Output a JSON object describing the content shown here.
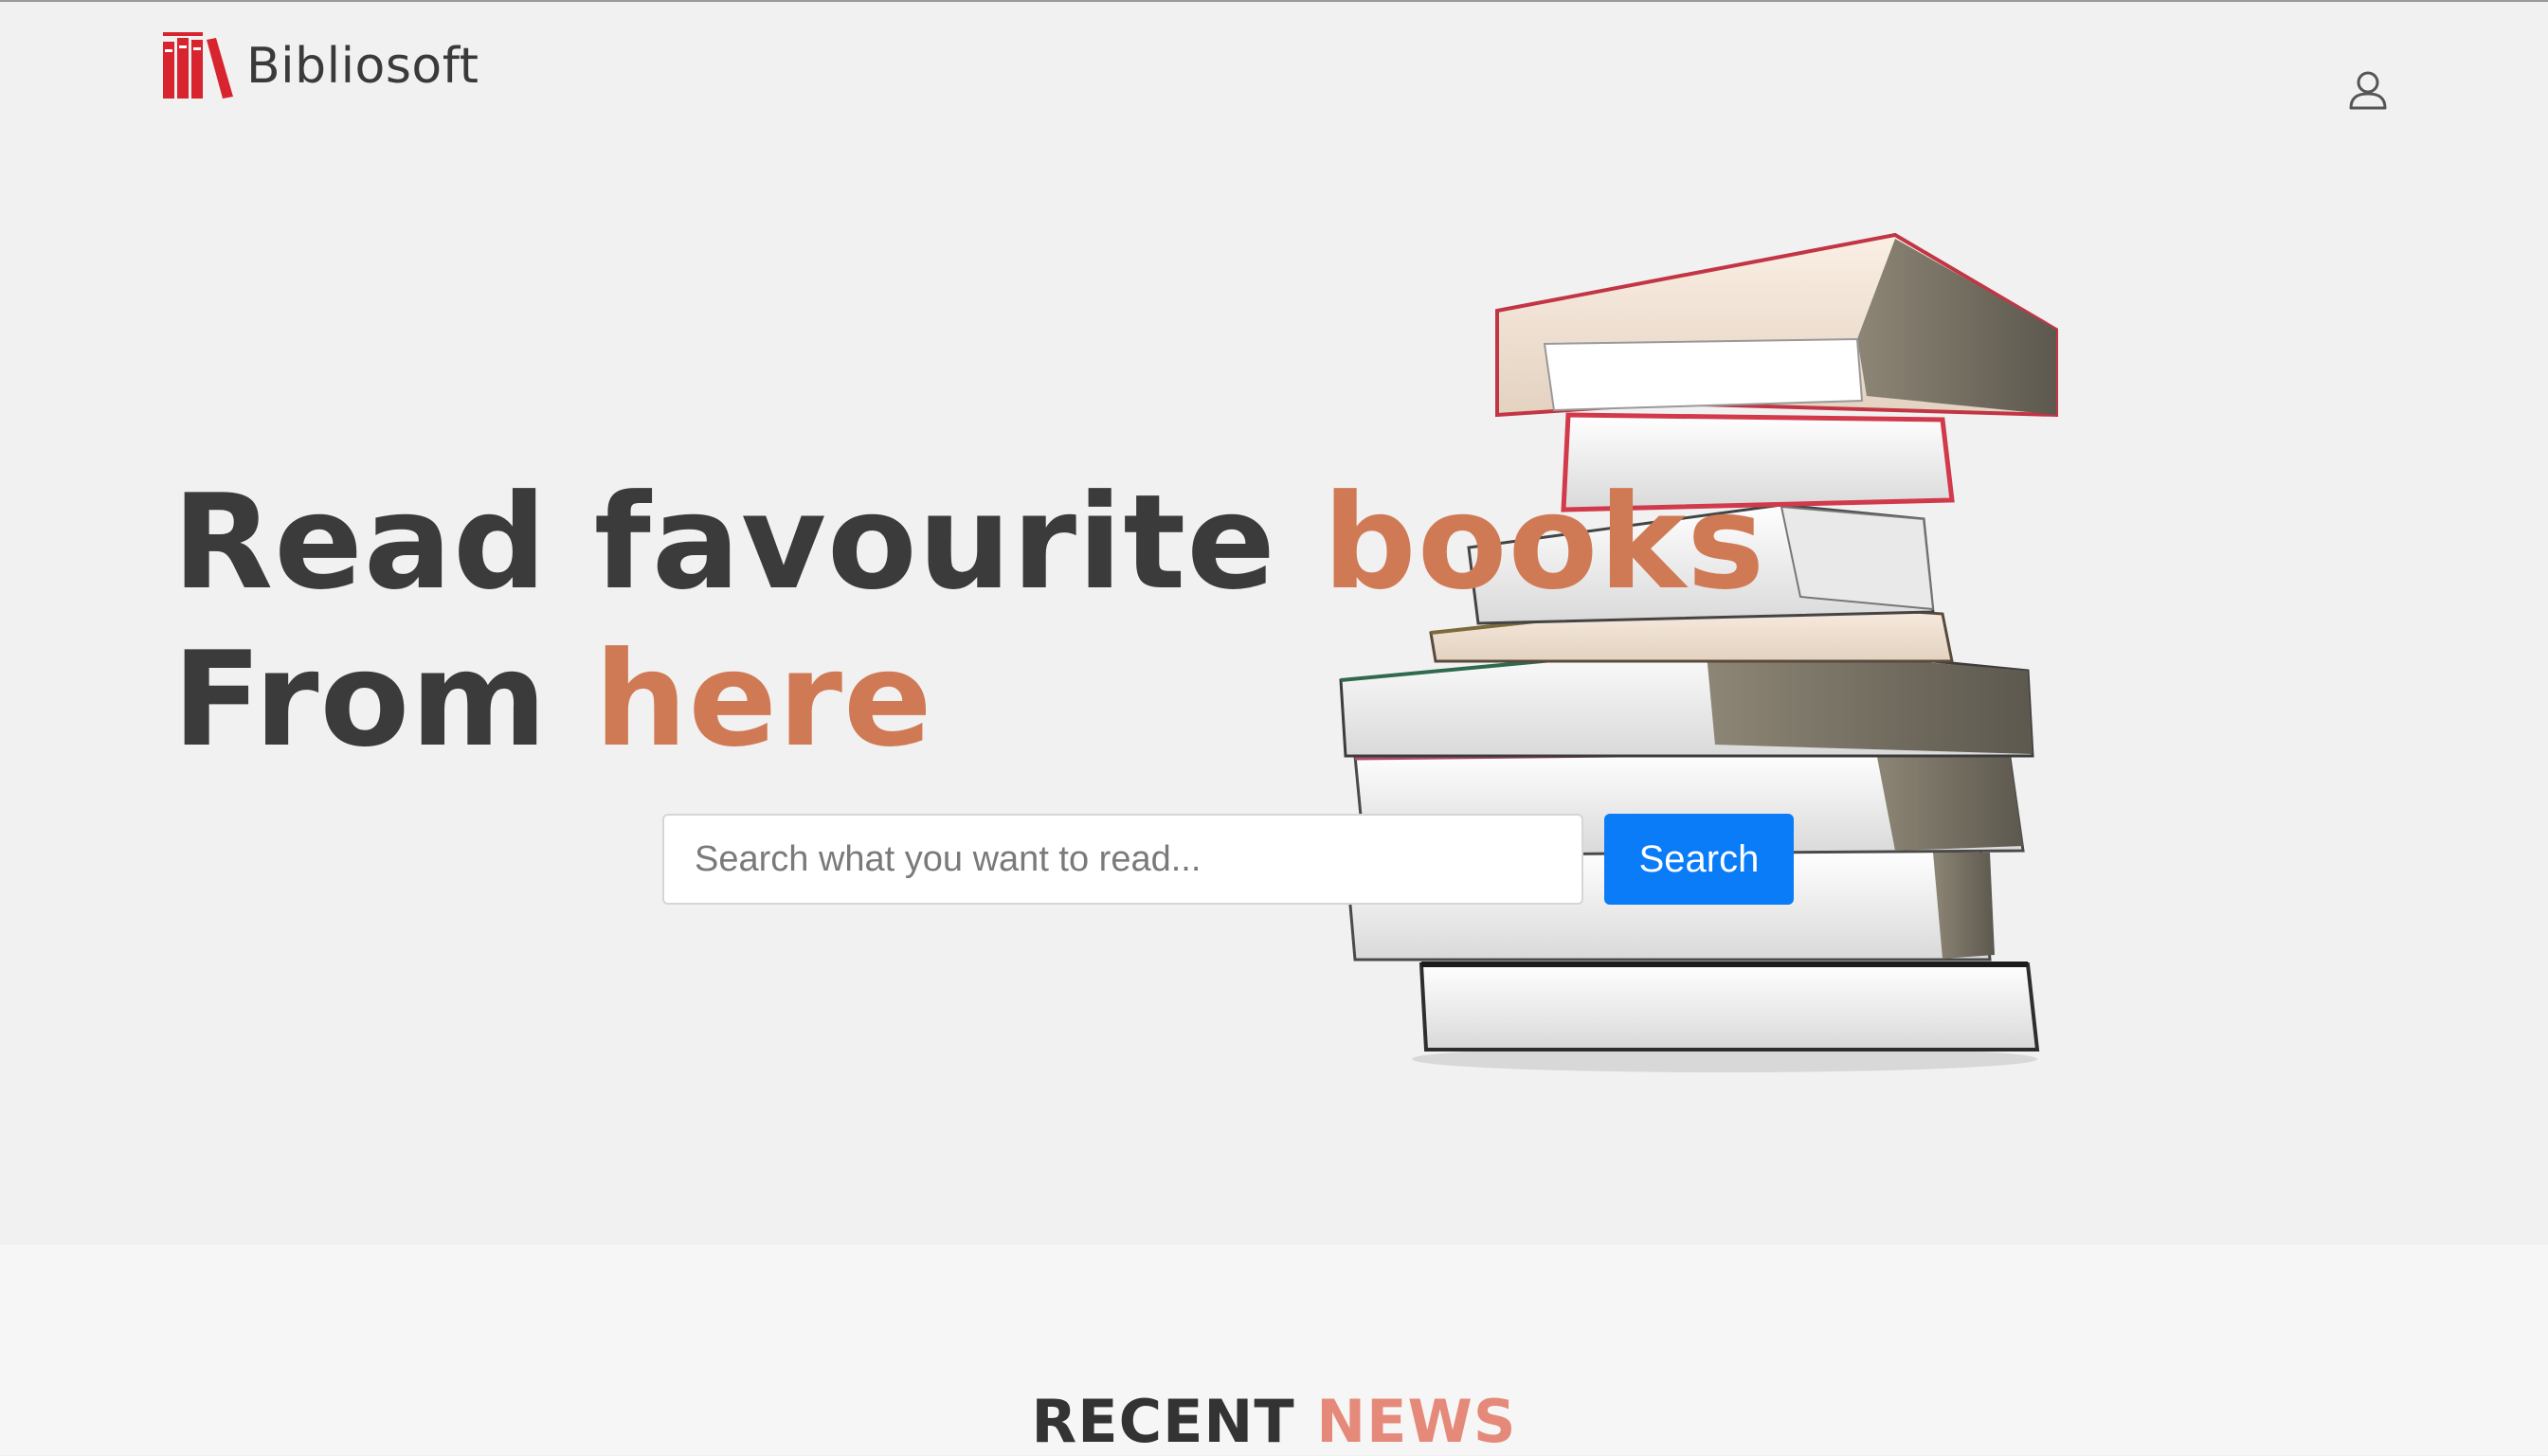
{
  "header": {
    "brand_name": "Bibliosoft",
    "logo_icon": "books-logo-icon",
    "user_icon": "user-icon"
  },
  "hero": {
    "headline_line1_main": "Read favourite ",
    "headline_line1_accent": "books",
    "headline_line2_main": "From ",
    "headline_line2_accent": "here",
    "image": "book-stack-image"
  },
  "search": {
    "placeholder": "Search what you want to read...",
    "value": "",
    "button_label": "Search"
  },
  "news": {
    "title_main": "RECENT ",
    "title_accent": "NEWS"
  },
  "colors": {
    "accent": "#d07a55",
    "news_accent": "#e58a7a",
    "primary_button": "#0a7cf8",
    "logo_red": "#d7242f",
    "text_dark": "#3b3b3b",
    "background": "#f1f1f1"
  }
}
